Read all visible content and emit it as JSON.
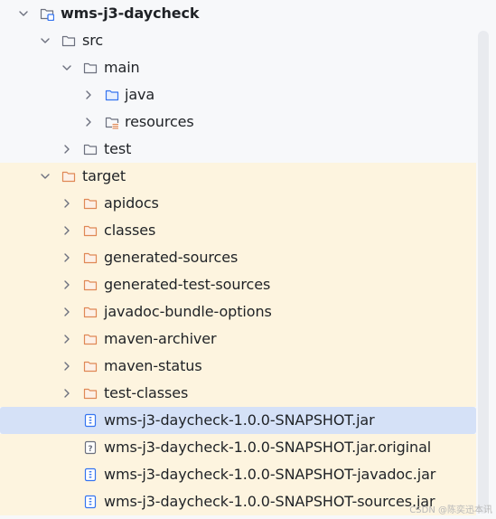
{
  "project": {
    "name": "wms-j3-daycheck"
  },
  "tree": {
    "src": {
      "label": "src",
      "main": {
        "label": "main",
        "java": "java",
        "resources": "resources"
      },
      "test": "test"
    },
    "target": {
      "label": "target",
      "folders": [
        "apidocs",
        "classes",
        "generated-sources",
        "generated-test-sources",
        "javadoc-bundle-options",
        "maven-archiver",
        "maven-status",
        "test-classes"
      ],
      "files": [
        "wms-j3-daycheck-1.0.0-SNAPSHOT.jar",
        "wms-j3-daycheck-1.0.0-SNAPSHOT.jar.original",
        "wms-j3-daycheck-1.0.0-SNAPSHOT-javadoc.jar",
        "wms-j3-daycheck-1.0.0-SNAPSHOT-sources.jar"
      ]
    }
  },
  "selected_file": "wms-j3-daycheck-1.0.0-SNAPSHOT.jar",
  "watermark": "CSDN @陈奕迅本讯",
  "colors": {
    "excluded_background": "#fdf4df",
    "selection_background": "#d5e1f7",
    "source_folder": "#3574f0",
    "excluded_folder": "#e08855",
    "plain_folder": "#6c707e",
    "resources_marker": "#e08855"
  }
}
